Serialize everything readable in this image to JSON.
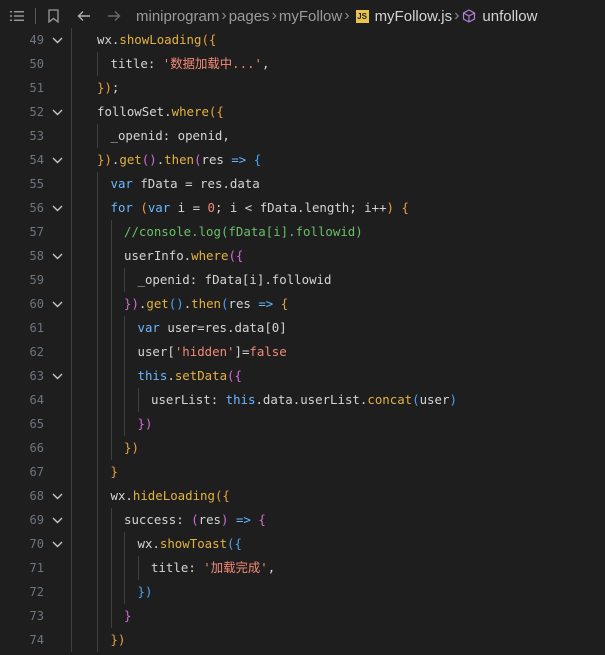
{
  "breadcrumb": {
    "segments": [
      "miniprogram",
      "pages",
      "myFollow"
    ],
    "file": "myFollow.js",
    "file_badge": "JS",
    "symbol": "unfollow"
  },
  "icons": {
    "menu": "list-icon",
    "bookmark": "bookmark-icon",
    "back": "arrow-left-icon",
    "forward": "arrow-right-icon",
    "symbol": "cube-icon"
  },
  "colors": {
    "background": "#1e1e1e",
    "line_number": "#6e7681",
    "keyword": "#6cb6ff",
    "function": "#e3b341",
    "string": "#f38a76",
    "comment": "#6abf69",
    "js_badge": "#e8c44a"
  },
  "lines": [
    {
      "n": "49",
      "fold": true,
      "indent": 0,
      "tokens": [
        [
          "t-ident",
          "wx."
        ],
        [
          "t-func",
          "showLoading"
        ],
        [
          "t-paren",
          "({"
        ]
      ]
    },
    {
      "n": "50",
      "fold": false,
      "indent": 1,
      "tokens": [
        [
          "t-prop",
          "title"
        ],
        [
          "t-punct",
          ": "
        ],
        [
          "t-str",
          "'数据加载中...'"
        ],
        [
          "t-punct",
          ","
        ]
      ]
    },
    {
      "n": "51",
      "fold": false,
      "indent": 0,
      "tokens": [
        [
          "t-paren",
          "})"
        ],
        [
          "t-punct",
          ";"
        ]
      ]
    },
    {
      "n": "52",
      "fold": true,
      "indent": 0,
      "tokens": [
        [
          "t-ident",
          "followSet."
        ],
        [
          "t-func",
          "where"
        ],
        [
          "t-paren",
          "({"
        ]
      ]
    },
    {
      "n": "53",
      "fold": false,
      "indent": 1,
      "tokens": [
        [
          "t-prop",
          "_openid"
        ],
        [
          "t-punct",
          ": openid,"
        ]
      ]
    },
    {
      "n": "54",
      "fold": true,
      "indent": 0,
      "tokens": [
        [
          "t-paren",
          "})"
        ],
        [
          "t-punct",
          "."
        ],
        [
          "t-func",
          "get"
        ],
        [
          "t-paren2",
          "()"
        ],
        [
          "t-punct",
          "."
        ],
        [
          "t-func",
          "then"
        ],
        [
          "t-paren2",
          "("
        ],
        [
          "t-ident",
          "res "
        ],
        [
          "t-kw",
          "=>"
        ],
        [
          "t-punct",
          " "
        ],
        [
          "t-paren3",
          "{"
        ]
      ]
    },
    {
      "n": "55",
      "fold": false,
      "indent": 1,
      "tokens": [
        [
          "t-kw",
          "var "
        ],
        [
          "t-ident",
          "fData = res.data"
        ]
      ]
    },
    {
      "n": "56",
      "fold": true,
      "indent": 1,
      "tokens": [
        [
          "t-kw",
          "for "
        ],
        [
          "t-paren",
          "("
        ],
        [
          "t-kw",
          "var "
        ],
        [
          "t-ident",
          "i = "
        ],
        [
          "t-num",
          "0"
        ],
        [
          "t-punct",
          "; i < fData.length; i++"
        ],
        [
          "t-paren",
          ")"
        ],
        [
          "t-punct",
          " "
        ],
        [
          "t-paren",
          "{"
        ]
      ]
    },
    {
      "n": "57",
      "fold": false,
      "indent": 2,
      "tokens": [
        [
          "t-comment",
          "//console.log(fData[i].followid)"
        ]
      ]
    },
    {
      "n": "58",
      "fold": true,
      "indent": 2,
      "tokens": [
        [
          "t-ident",
          "userInfo."
        ],
        [
          "t-func",
          "where"
        ],
        [
          "t-paren2",
          "({"
        ]
      ]
    },
    {
      "n": "59",
      "fold": false,
      "indent": 3,
      "tokens": [
        [
          "t-prop",
          "_openid"
        ],
        [
          "t-punct",
          ": fData[i].followid"
        ]
      ]
    },
    {
      "n": "60",
      "fold": true,
      "indent": 2,
      "tokens": [
        [
          "t-paren2",
          "})"
        ],
        [
          "t-punct",
          "."
        ],
        [
          "t-func",
          "get"
        ],
        [
          "t-paren3",
          "()"
        ],
        [
          "t-punct",
          "."
        ],
        [
          "t-func",
          "then"
        ],
        [
          "t-paren3",
          "("
        ],
        [
          "t-ident",
          "res "
        ],
        [
          "t-kw",
          "=>"
        ],
        [
          "t-punct",
          " "
        ],
        [
          "t-paren",
          "{"
        ]
      ]
    },
    {
      "n": "61",
      "fold": false,
      "indent": 3,
      "tokens": [
        [
          "t-kw",
          "var "
        ],
        [
          "t-ident",
          "user=res.data[0]"
        ]
      ]
    },
    {
      "n": "62",
      "fold": false,
      "indent": 3,
      "tokens": [
        [
          "t-ident",
          "user["
        ],
        [
          "t-str",
          "'hidden'"
        ],
        [
          "t-ident",
          "]="
        ],
        [
          "t-bool",
          "false"
        ]
      ]
    },
    {
      "n": "63",
      "fold": true,
      "indent": 3,
      "tokens": [
        [
          "t-kw",
          "this"
        ],
        [
          "t-punct",
          "."
        ],
        [
          "t-func",
          "setData"
        ],
        [
          "t-paren2",
          "({"
        ]
      ]
    },
    {
      "n": "64",
      "fold": false,
      "indent": 4,
      "tokens": [
        [
          "t-prop",
          "userList"
        ],
        [
          "t-punct",
          ": "
        ],
        [
          "t-kw",
          "this"
        ],
        [
          "t-punct",
          ".data.userList."
        ],
        [
          "t-func",
          "concat"
        ],
        [
          "t-paren3",
          "("
        ],
        [
          "t-ident",
          "user"
        ],
        [
          "t-paren3",
          ")"
        ]
      ]
    },
    {
      "n": "65",
      "fold": false,
      "indent": 3,
      "tokens": [
        [
          "t-paren2",
          "})"
        ]
      ]
    },
    {
      "n": "66",
      "fold": false,
      "indent": 2,
      "tokens": [
        [
          "t-paren",
          "})"
        ]
      ]
    },
    {
      "n": "67",
      "fold": false,
      "indent": 1,
      "tokens": [
        [
          "t-paren",
          "}"
        ]
      ]
    },
    {
      "n": "68",
      "fold": true,
      "indent": 1,
      "tokens": [
        [
          "t-ident",
          "wx."
        ],
        [
          "t-func",
          "hideLoading"
        ],
        [
          "t-paren",
          "({"
        ]
      ]
    },
    {
      "n": "69",
      "fold": true,
      "indent": 2,
      "tokens": [
        [
          "t-prop",
          "success"
        ],
        [
          "t-punct",
          ": "
        ],
        [
          "t-paren2",
          "("
        ],
        [
          "t-ident",
          "res"
        ],
        [
          "t-paren2",
          ")"
        ],
        [
          "t-punct",
          " "
        ],
        [
          "t-kw",
          "=>"
        ],
        [
          "t-punct",
          " "
        ],
        [
          "t-paren2",
          "{"
        ]
      ]
    },
    {
      "n": "70",
      "fold": true,
      "indent": 3,
      "tokens": [
        [
          "t-ident",
          "wx."
        ],
        [
          "t-func",
          "showToast"
        ],
        [
          "t-paren3",
          "({"
        ]
      ]
    },
    {
      "n": "71",
      "fold": false,
      "indent": 4,
      "tokens": [
        [
          "t-prop",
          "title"
        ],
        [
          "t-punct",
          ": "
        ],
        [
          "t-str",
          "'加载完成'"
        ],
        [
          "t-punct",
          ","
        ]
      ]
    },
    {
      "n": "72",
      "fold": false,
      "indent": 3,
      "tokens": [
        [
          "t-paren3",
          "})"
        ]
      ]
    },
    {
      "n": "73",
      "fold": false,
      "indent": 2,
      "tokens": [
        [
          "t-paren2",
          "}"
        ]
      ]
    },
    {
      "n": "74",
      "fold": false,
      "indent": 1,
      "tokens": [
        [
          "t-paren",
          "})"
        ]
      ]
    }
  ]
}
